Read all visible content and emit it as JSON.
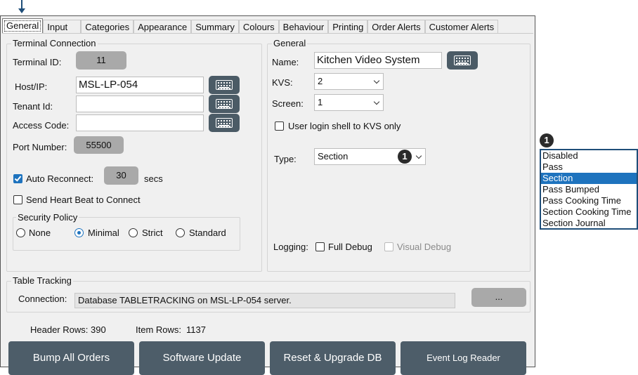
{
  "tabs": [
    "General",
    "Input",
    "Categories",
    "Appearance",
    "Summary",
    "Colours",
    "Behaviour",
    "Printing",
    "Order Alerts",
    "Customer Alerts"
  ],
  "terminal": {
    "title": "Terminal Connection",
    "terminal_id_label": "Terminal ID:",
    "terminal_id": "11",
    "host_label": "Host/IP:",
    "host_value": "MSL-LP-054",
    "tenant_label": "Tenant Id:",
    "tenant_value": "",
    "access_label": "Access Code:",
    "access_value": "",
    "port_label": "Port Number:",
    "port_value": "55500",
    "auto_reconnect_label": "Auto Reconnect:",
    "auto_reconnect_checked": true,
    "auto_reconnect_value": "30",
    "auto_reconnect_unit": "secs",
    "heartbeat_label": "Send Heart Beat to Connect",
    "security": {
      "title": "Security Policy",
      "options": [
        "None",
        "Minimal",
        "Strict",
        "Standard"
      ],
      "selected": "Minimal"
    }
  },
  "general": {
    "title": "General",
    "name_label": "Name:",
    "name_value": "Kitchen Video System",
    "kvs_label": "KVS:",
    "kvs_value": "2",
    "screen_label": "Screen:",
    "screen_value": "1",
    "login_shell_label": "User login shell to KVS only",
    "type_label": "Type:",
    "type_value": "Section",
    "type_badge": "1",
    "logging_label": "Logging:",
    "full_debug_label": "Full Debug",
    "visual_debug_label": "Visual Debug"
  },
  "table_tracking": {
    "title": "Table Tracking",
    "connection_label": "Connection:",
    "connection_value": "Database TABLETRACKING on MSL-LP-054 server.",
    "browse_label": "..."
  },
  "status": {
    "header_rows_label": "Header Rows:",
    "header_rows_value": "390",
    "item_rows_label": "Item Rows:",
    "item_rows_value": "1137"
  },
  "buttons": {
    "bump_all": "Bump All Orders",
    "software_update": "Software Update",
    "reset_upgrade": "Reset & Upgrade DB",
    "event_log": "Event Log Reader"
  },
  "type_dropdown": {
    "badge": "1",
    "options": [
      "Disabled",
      "Pass",
      "Section",
      "Pass Bumped",
      "Pass Cooking Time",
      "Section Cooking Time",
      "Section Journal"
    ],
    "selected": "Section"
  },
  "colors": {
    "accent": "#1e73be",
    "button": "#4d5d69",
    "keyboard_button": "#4b5b66",
    "pill": "#a9a9a9",
    "callout": "#1f4e79"
  }
}
